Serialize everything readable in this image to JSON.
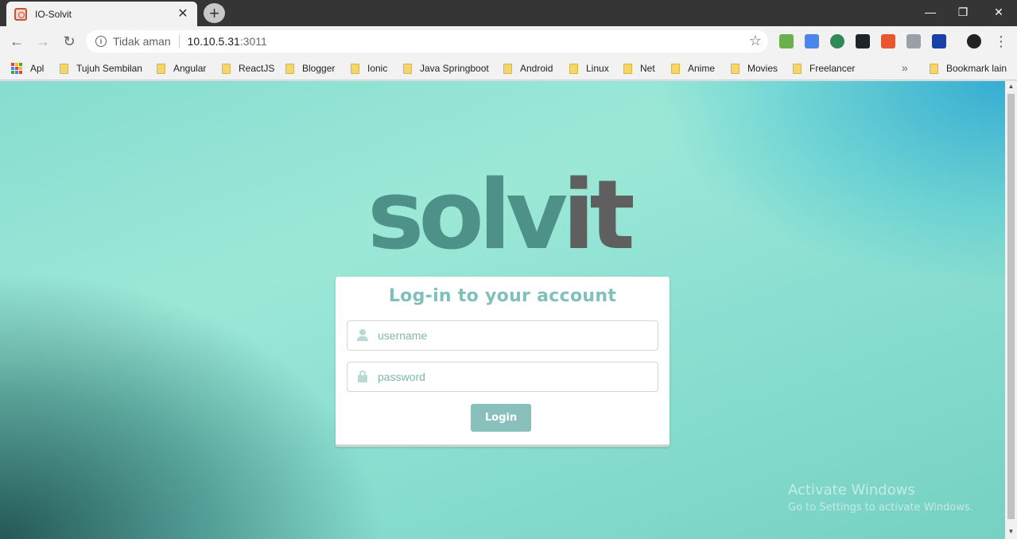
{
  "browser": {
    "tab": {
      "title": "IO-Solvit",
      "close_glyph": "✕",
      "favicon": "solvit-favicon-icon"
    },
    "new_tab_glyph": "+",
    "window_controls": {
      "minimize": "—",
      "restore": "❐",
      "close": "✕"
    },
    "nav": {
      "back": "←",
      "forward": "→",
      "reload": "↻",
      "menu": "⋮"
    },
    "address": {
      "security_label": "Tidak aman",
      "host": "10.10.5.31",
      "port": ":3011",
      "star": "☆"
    },
    "extensions": [
      {
        "name": "download-extension-icon",
        "color": "#6ab04c"
      },
      {
        "name": "translate-extension-icon",
        "color": "#4a86e8"
      },
      {
        "name": "globe-extension-icon",
        "color": "#2e8b57"
      },
      {
        "name": "react-devtools-icon",
        "color": "#20232a"
      },
      {
        "name": "off-extension-icon",
        "color": "#e8552f"
      },
      {
        "name": "cast-extension-icon",
        "color": "#9aa0a6"
      },
      {
        "name": "info-extension-icon",
        "color": "#1a3fa8"
      },
      {
        "name": "profile-avatar-icon",
        "color": "#222222"
      }
    ]
  },
  "bookmarks": {
    "apps_label": "Apl",
    "items": [
      "Tujuh Sembilan",
      "Angular",
      "ReactJS",
      "Blogger",
      "Ionic",
      "Java Springboot",
      "Android",
      "Linux",
      "Net",
      "Anime",
      "Movies",
      "Freelancer"
    ],
    "more_glyph": "»",
    "other_label": "Bookmark lain"
  },
  "page": {
    "logo": {
      "part1": "solv",
      "part2": "it"
    },
    "form": {
      "title": "Log-in to your account",
      "username_placeholder": "username",
      "password_placeholder": "password",
      "login_label": "Login"
    }
  },
  "os_watermark": {
    "line1": "Activate Windows",
    "line2": "Go to Settings to activate Windows."
  }
}
